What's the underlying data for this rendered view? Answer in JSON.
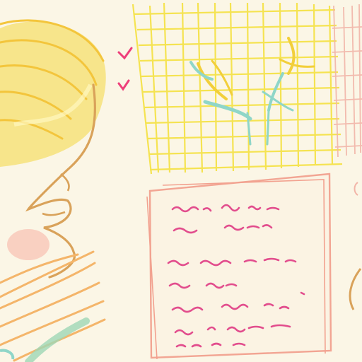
{
  "palette": {
    "paper": "#fbf6e6",
    "hair": "#f6e27a",
    "hair_outline": "#f3c53c",
    "skin_outline": "#d9a25a",
    "blush": "#f7b0a3",
    "grid_yellow": "#f5e24a",
    "grid_pink": "#f2b5a8",
    "flower_yellow": "#f2cf3a",
    "leaf_teal": "#8fd6c8",
    "heart_pink": "#ee3f7a",
    "note_outline": "#f2a18f",
    "scribble_pink": "#e24d8d",
    "sleeve_orange": "#f4b56a",
    "sleeve_green": "#9fd7b5"
  },
  "scene": {
    "subjects": [
      "girl-profile",
      "window-grid",
      "flowers",
      "hearts",
      "handwritten-note"
    ]
  }
}
